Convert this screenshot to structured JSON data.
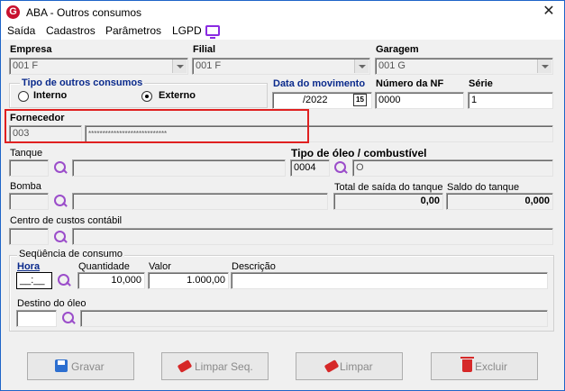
{
  "window": {
    "title": "ABA - Outros consumos",
    "close_glyph": "✕",
    "app_icon_letter": "G"
  },
  "menu": {
    "items": [
      "Saída",
      "Cadastros",
      "Parâmetros",
      "LGPD"
    ]
  },
  "empresa": {
    "label": "Empresa",
    "value": "001 F"
  },
  "filial": {
    "label": "Filial",
    "value": "001 F"
  },
  "garagem": {
    "label": "Garagem",
    "value": "001 G"
  },
  "tipo_outros": {
    "label": "Tipo de outros consumos",
    "options": [
      "Interno",
      "Externo"
    ],
    "selected": "Externo"
  },
  "data_movimento": {
    "label": "Data do movimento",
    "value": "/2022",
    "calendar_label": "15"
  },
  "numero_nf": {
    "label": "Número da NF",
    "value": "0000"
  },
  "serie": {
    "label": "Série",
    "value": "1"
  },
  "fornecedor": {
    "label": "Fornecedor",
    "code": "003",
    "name": "****************************"
  },
  "tanque": {
    "label": "Tanque",
    "value": "",
    "name": ""
  },
  "tipo_oleo": {
    "label": "Tipo de óleo / combustível",
    "code": "0004",
    "name": "O"
  },
  "bomba": {
    "label": "Bomba",
    "value": "",
    "name": ""
  },
  "total_saida": {
    "label": "Total de saída do tanque",
    "value": "0,00"
  },
  "saldo_tanque": {
    "label": "Saldo do tanque",
    "value": "0,000"
  },
  "centro_custos": {
    "label": "Centro de custos contábil",
    "value": "",
    "name": ""
  },
  "sequencia": {
    "label": "Seqüência de consumo",
    "hora_label": "Hora",
    "hora_value": "__:__",
    "quantidade_label": "Quantidade",
    "quantidade_value": "10,000",
    "valor_label": "Valor",
    "valor_value": "1.000,00",
    "descricao_label": "Descrição",
    "descricao_value": ""
  },
  "destino_oleo": {
    "label": "Destino do óleo",
    "value": "",
    "name": ""
  },
  "buttons": {
    "gravar": "Gravar",
    "limpar_seq": "Limpar Seq.",
    "limpar": "Limpar",
    "excluir": "Excluir"
  }
}
